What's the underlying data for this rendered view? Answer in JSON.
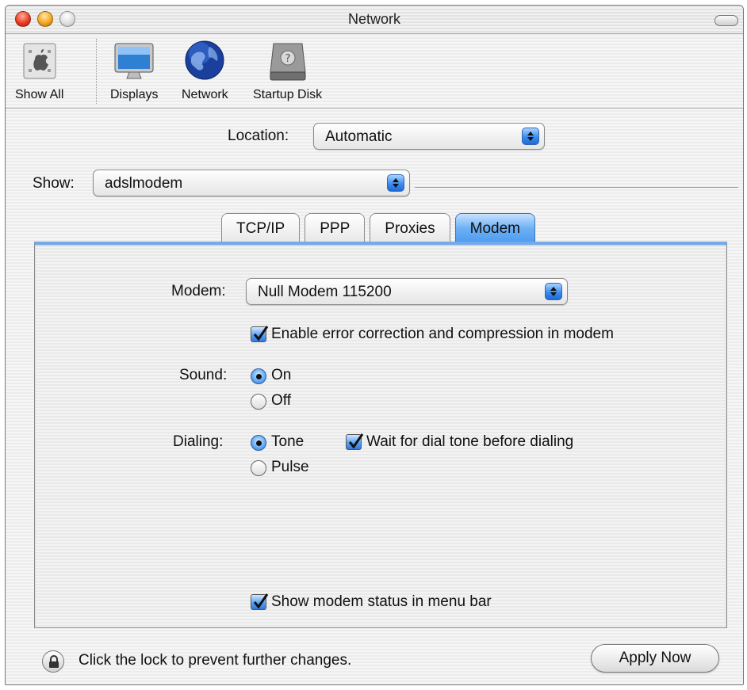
{
  "window": {
    "title": "Network"
  },
  "toolbar": {
    "items": [
      {
        "label": "Show All",
        "icon": "apple-show-all-icon"
      },
      {
        "label": "Displays",
        "icon": "monitor-icon"
      },
      {
        "label": "Network",
        "icon": "globe-icon"
      },
      {
        "label": "Startup Disk",
        "icon": "hard-disk-icon"
      }
    ]
  },
  "location": {
    "label": "Location:",
    "value": "Automatic"
  },
  "show": {
    "label": "Show:",
    "value": "adslmodem"
  },
  "tabs": [
    {
      "label": "TCP/IP",
      "active": false
    },
    {
      "label": "PPP",
      "active": false
    },
    {
      "label": "Proxies",
      "active": false
    },
    {
      "label": "Modem",
      "active": true
    }
  ],
  "modem_panel": {
    "modem_label": "Modem:",
    "modem_value": "Null Modem 115200",
    "error_correction_label": "Enable error correction and compression in modem",
    "error_correction_checked": true,
    "sound_label": "Sound:",
    "sound_options": [
      "On",
      "Off"
    ],
    "sound_selected": "On",
    "dialing_label": "Dialing:",
    "dialing_options": [
      "Tone",
      "Pulse"
    ],
    "dialing_selected": "Tone",
    "wait_dial_tone_label": "Wait for dial tone before dialing",
    "wait_dial_tone_checked": true,
    "show_status_label": "Show modem status in menu bar",
    "show_status_checked": true
  },
  "footer": {
    "lock_text": "Click the lock to prevent further changes.",
    "apply_label": "Apply Now"
  },
  "colors": {
    "accent_blue": "#4d9bef",
    "close": "#ee3b22",
    "minimize": "#f3a521"
  }
}
